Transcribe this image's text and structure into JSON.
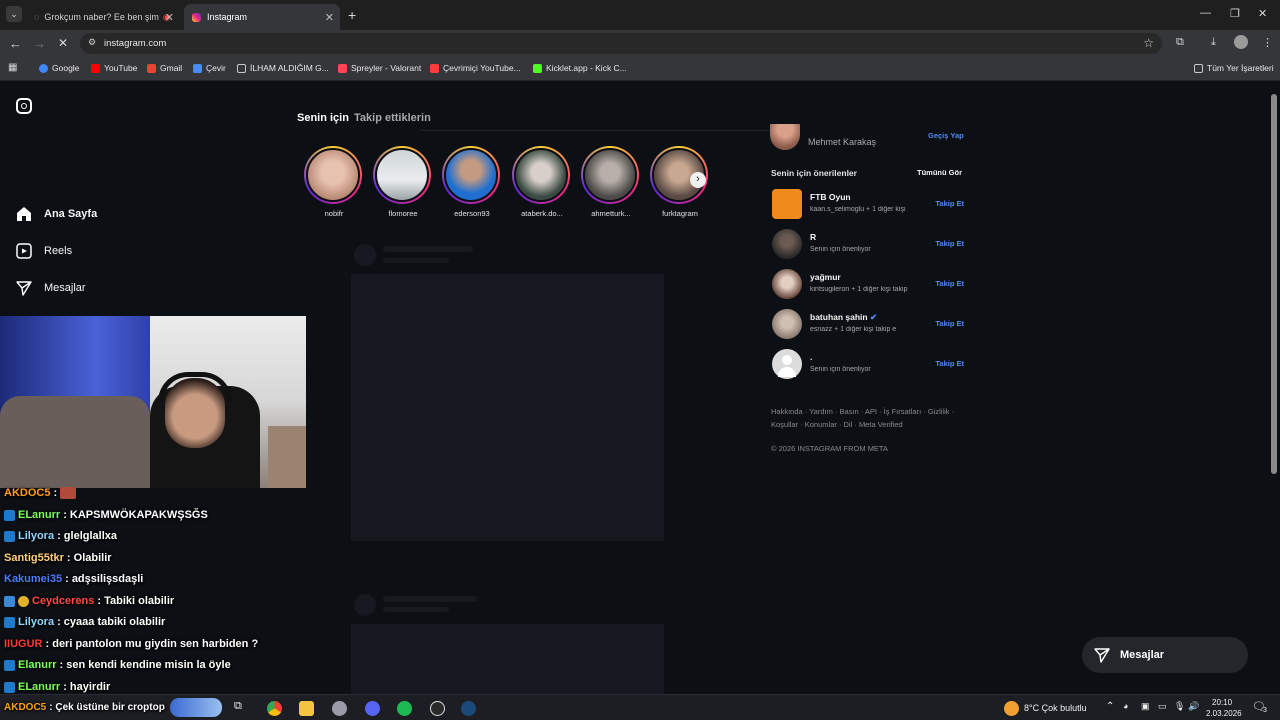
{
  "browser": {
    "tabs": [
      {
        "title": "Grokçum naber? Ee ben şim",
        "active": false
      },
      {
        "title": "Instagram",
        "active": true
      }
    ],
    "url": "instagram.com",
    "bookmarks": [
      {
        "label": "Google",
        "color": "#4285f4"
      },
      {
        "label": "YouTube",
        "color": "#ff0000"
      },
      {
        "label": "Gmail",
        "color": "#ea4335"
      },
      {
        "label": "Çevir",
        "color": "#4a8af4"
      },
      {
        "label": "İLHAM ALDIĞIM G...",
        "color": "#c8c8c8"
      },
      {
        "label": "Spreyler - Valorant",
        "color": "#ff4655"
      },
      {
        "label": "Çevrimiçi YouTube...",
        "color": "#ff3b3b"
      },
      {
        "label": "Kicklet.app - Kick C...",
        "color": "#53fc18"
      }
    ],
    "all_bookmarks": "Tüm Yer İşaretleri"
  },
  "instagram": {
    "nav": [
      "Ana Sayfa",
      "Reels",
      "Mesajlar"
    ],
    "feed_tabs": [
      "Senin için",
      "Takip ettiklerin"
    ],
    "stories": [
      "nobifr",
      "flomoree",
      "ederson93",
      "ataberk.do...",
      "ahmetturk...",
      "furktagram"
    ],
    "account": {
      "name": "Mehmet Karakaş",
      "switch": "Geçiş Yap"
    },
    "suggestions_title": "Senin için önerilenler",
    "see_all": "Tümünü Gör",
    "suggestions": [
      {
        "name": "FTB Oyun",
        "sub": "kaan.s_selimoglu + 1 diğer kişi",
        "follow": "Takip Et",
        "color": "#f08a1c"
      },
      {
        "name": "R",
        "sub": "Senin için öneriliyor",
        "follow": "Takip Et",
        "color": "#3b3b3b"
      },
      {
        "name": "yağmur",
        "sub": "kintsugileron + 1 diğer kişi takip",
        "follow": "Takip Et",
        "color": "#d9c3b0"
      },
      {
        "name": "batuhan şahin",
        "sub": "esnazz + 1 diğer kişi takip e",
        "follow": "Takip Et",
        "color": "#b8a89a"
      },
      {
        "name": ".",
        "sub": "Senin için öneriliyor",
        "follow": "Takip Et",
        "color": "#dcdcdc"
      }
    ],
    "footer_links_1": "Hakkında · Yardım · Basın · API · İş Fırsatları · Gizlilik ·",
    "footer_links_2": "Koşullar · Konumlar · Dil · Meta Verified",
    "copyright": "© 2026 INSTAGRAM FROM META",
    "messages_button": "Mesajlar"
  },
  "chat": [
    {
      "user": "AKDOC5",
      "text": ":",
      "color": "#ff9f1c"
    },
    {
      "user": "ELanurr",
      "text": ": KAPSMWÖKAPAKWŞSĞS",
      "color": "#7cff5a"
    },
    {
      "user": "Lilyora",
      "text": ": glelglallxa",
      "color": "#8fd6ff"
    },
    {
      "user": "Santig55tkr",
      "text": ": Olabilir",
      "color": "#ffd27a"
    },
    {
      "user": "Kakumei35",
      "text": ": adşsilişsdaşli",
      "color": "#4f7cff"
    },
    {
      "user": "Ceydcerens",
      "text": ": Tabiki olabilir",
      "color": "#ff4a4a"
    },
    {
      "user": "Lilyora",
      "text": ": cyaaa tabiki olabilir",
      "color": "#8fd6ff"
    },
    {
      "user": "IIUGUR",
      "text": ": deri pantolon mu giydin sen harbiden ?",
      "color": "#ff3b3b"
    },
    {
      "user": "Elanurr",
      "text": ": sen kendi kendine misin la öyle",
      "color": "#7cff5a"
    },
    {
      "user": "ELanurr",
      "text": ": hayirdir",
      "color": "#7cff5a"
    },
    {
      "user": "AKDOC5",
      "text": ": Çek üstüne bir croptop",
      "color": "#ff9f1c"
    }
  ],
  "taskbar": {
    "weather": "8°C  Çok bulutlu",
    "time": "20:10",
    "date": "2.03.2026",
    "notif_count": "3"
  }
}
